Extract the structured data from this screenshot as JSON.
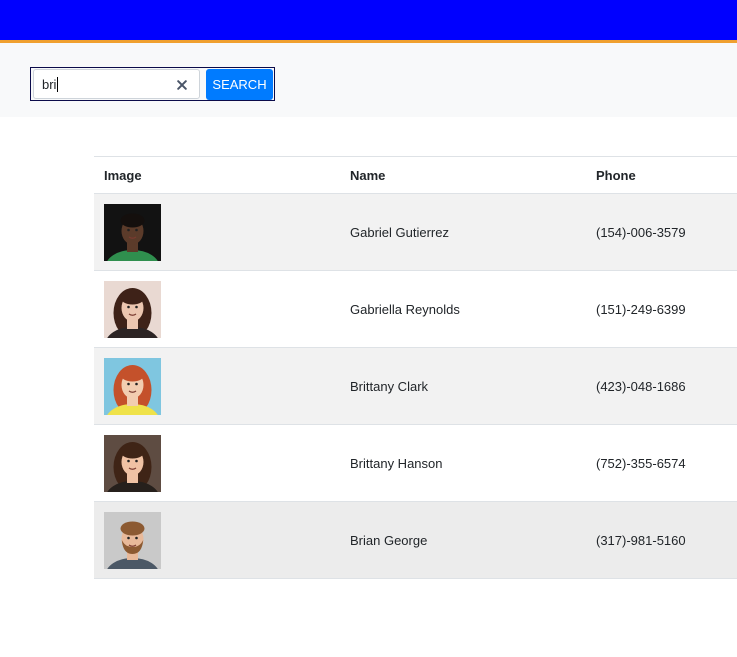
{
  "theme": {
    "header_bg": "#0000ff",
    "header_accent": "#f0a030",
    "band_bg": "#f8f9fa",
    "search_button_bg": "#007bff"
  },
  "search": {
    "value": "bri",
    "clear_icon": "close-icon",
    "button_label": "SEARCH"
  },
  "table": {
    "columns": [
      "Image",
      "Name",
      "Phone"
    ],
    "rows": [
      {
        "name": "Gabriel Gutierrez",
        "phone": "(154)-006-3579"
      },
      {
        "name": "Gabriella Reynolds",
        "phone": "(151)-249-6399"
      },
      {
        "name": "Brittany Clark",
        "phone": "(423)-048-1686"
      },
      {
        "name": "Brittany Hanson",
        "phone": "(752)-355-6574"
      },
      {
        "name": "Brian George",
        "phone": "(317)-981-5160"
      }
    ]
  }
}
